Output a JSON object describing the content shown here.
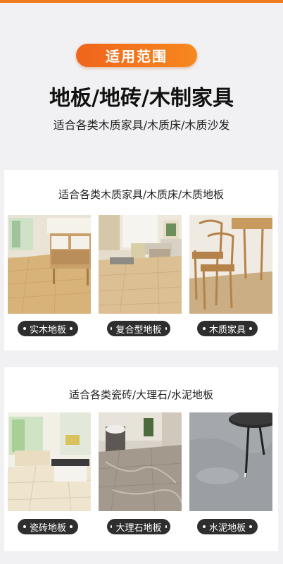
{
  "header": {
    "badge": "适用范围",
    "headline": "地板/地砖/木制家具",
    "subtitle": "适合各类木质家具/木质床/木质沙发"
  },
  "section_wood": {
    "title": "适合各类木质家具/木质床/木质地板",
    "items": [
      {
        "label": "实木地板",
        "image": "wood-floor-living-room"
      },
      {
        "label": "复合型地板",
        "image": "laminate-floor-sofa"
      },
      {
        "label": "木质家具",
        "image": "wooden-chairs-table"
      }
    ]
  },
  "section_stone": {
    "title": "适合各类瓷砖/大理石/水泥地板",
    "items": [
      {
        "label": "瓷砖地板",
        "image": "ceramic-tile-living-room"
      },
      {
        "label": "大理石地板",
        "image": "marble-floor-washroom"
      },
      {
        "label": "水泥地板",
        "image": "concrete-floor-side-table"
      }
    ]
  },
  "colors": {
    "accent": "#f07a1e",
    "tag_bg": "#2e2e2e",
    "page_bg": "#f1f1f3"
  }
}
